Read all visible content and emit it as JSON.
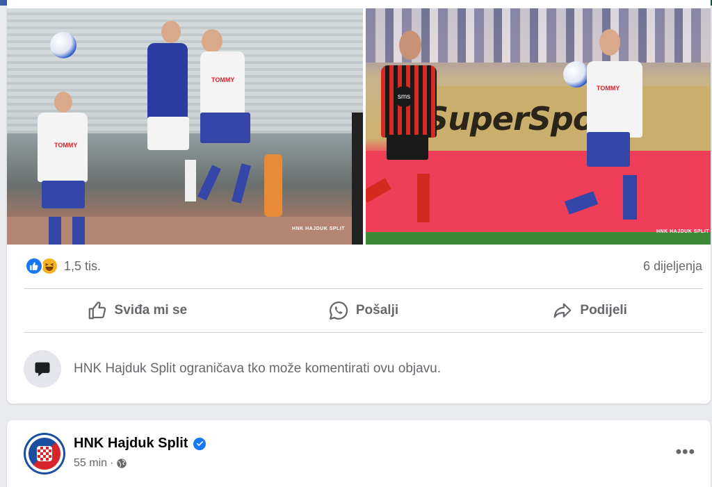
{
  "reactions": {
    "count": "1,5 tis.",
    "shares": "6 dijeljenja",
    "icons": [
      "like-icon",
      "haha-icon"
    ]
  },
  "actions": [
    {
      "label": "Sviđa mi se",
      "icon": "thumbs-up-icon"
    },
    {
      "label": "Pošalji",
      "icon": "whatsapp-icon"
    },
    {
      "label": "Podijeli",
      "icon": "share-arrow-icon"
    }
  ],
  "restriction": {
    "text": "HNK Hajduk Split ograničava tko može komentirati ovu objavu.",
    "icon": "speech-bubble-icon"
  },
  "photos": {
    "left": {
      "jersey_text": "TOMMY",
      "watermark": "HNK HAJDUK SPLIT"
    },
    "right": {
      "board_text": "SuperSport",
      "jersey_text": "TOMMY",
      "sponsor": "sms",
      "watermark": "HNK HAJDUK SPLIT"
    }
  },
  "next_post": {
    "page_name": "HNK Hajduk Split",
    "time": "55 min",
    "separator": "·",
    "more": "•••"
  },
  "colors": {
    "accent": "#1877f2",
    "secondary_text": "#65676b",
    "background": "#e9ebee"
  }
}
